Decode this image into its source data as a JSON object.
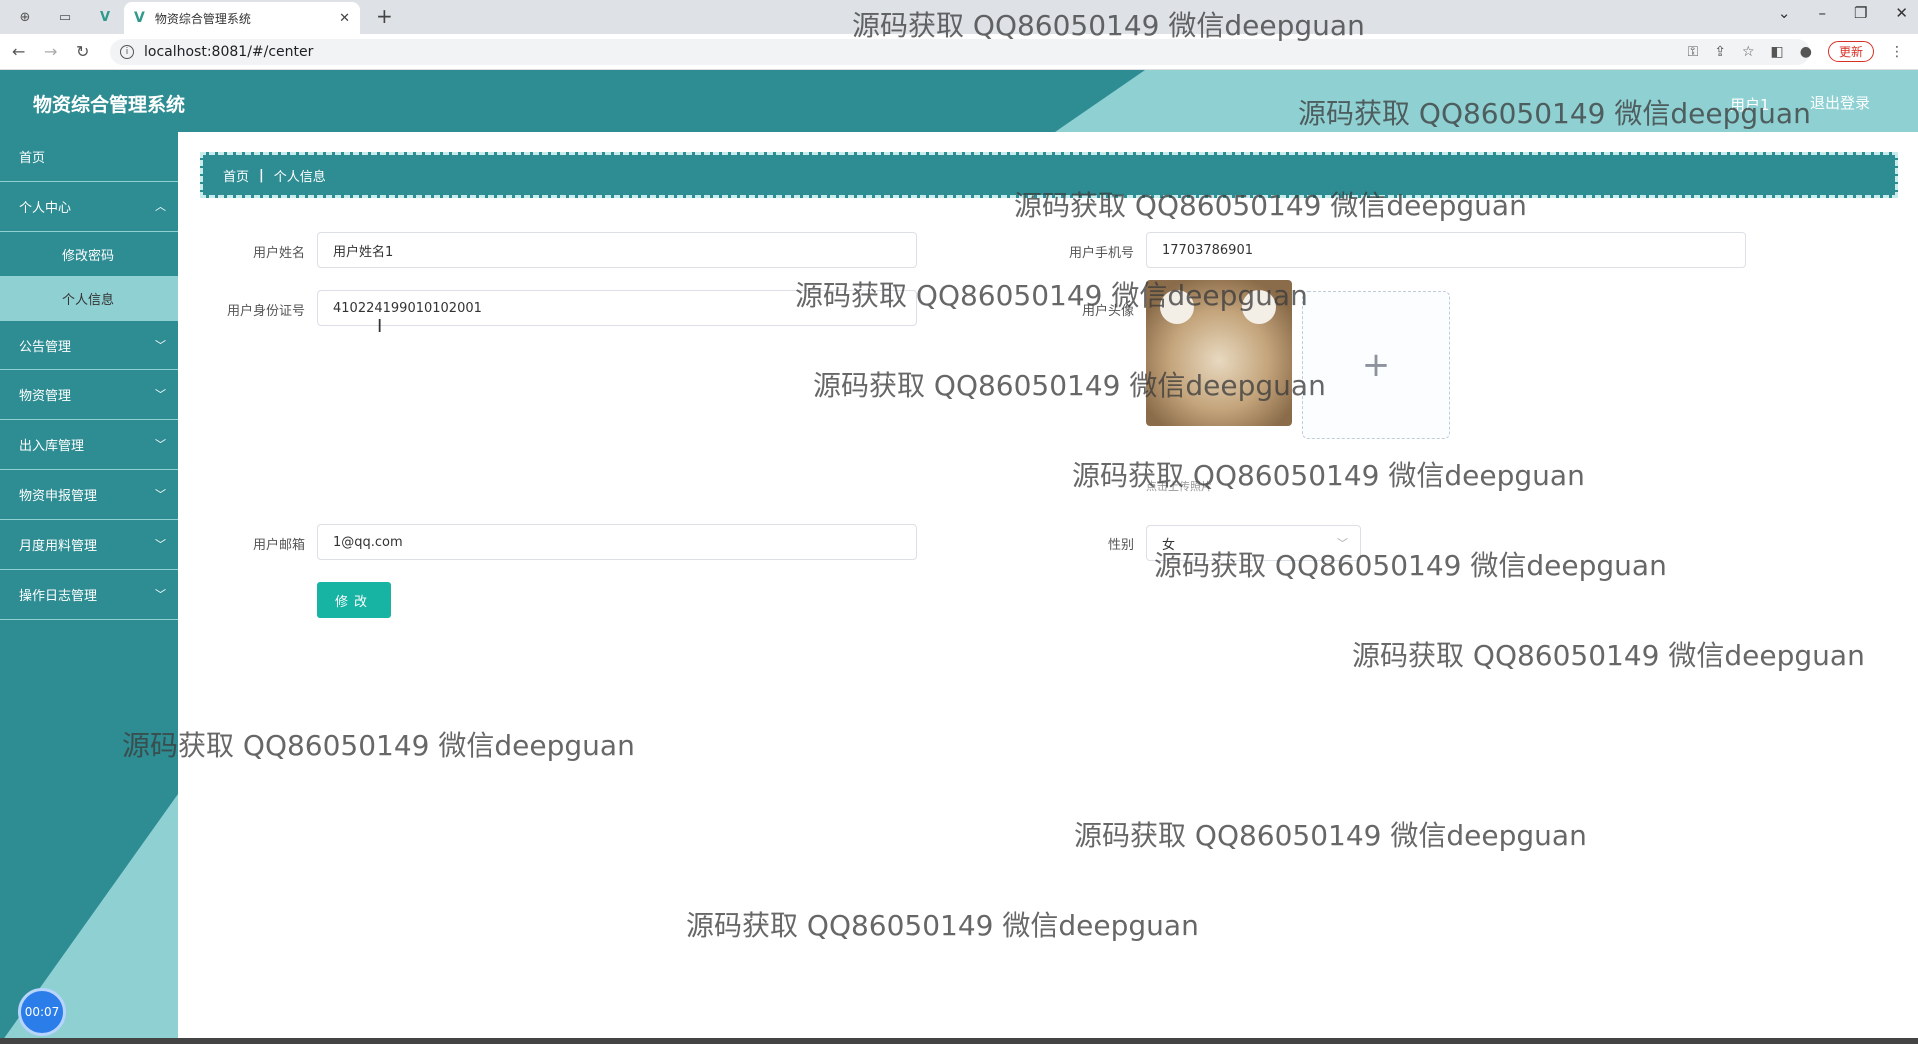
{
  "browser": {
    "tab_title": "物资综合管理系统",
    "url": "localhost:8081/#/center",
    "update_label": "更新"
  },
  "header": {
    "title": "物资综合管理系统",
    "user_label": "用户1",
    "logout_label": "退出登录"
  },
  "sidebar": {
    "items": [
      {
        "label": "首页"
      },
      {
        "label": "个人中心"
      },
      {
        "label": "修改密码"
      },
      {
        "label": "个人信息"
      },
      {
        "label": "公告管理"
      },
      {
        "label": "物资管理"
      },
      {
        "label": "出入库管理"
      },
      {
        "label": "物资申报管理"
      },
      {
        "label": "月度用料管理"
      },
      {
        "label": "操作日志管理"
      }
    ],
    "timer": "00:07"
  },
  "breadcrumb": {
    "home": "首页",
    "current": "个人信息"
  },
  "form": {
    "name_label": "用户姓名",
    "name_value": "用户姓名1",
    "phone_label": "用户手机号",
    "phone_value": "17703786901",
    "idcard_label": "用户身份证号",
    "idcard_value": "410224199010102001",
    "avatar_label": "用户头像",
    "upload_tip": "点击上传照片",
    "email_label": "用户邮箱",
    "email_value": "1@qq.com",
    "gender_label": "性别",
    "gender_value": "女",
    "submit_label": "修改"
  },
  "watermark": "源码获取 QQ86050149 微信deepguan"
}
